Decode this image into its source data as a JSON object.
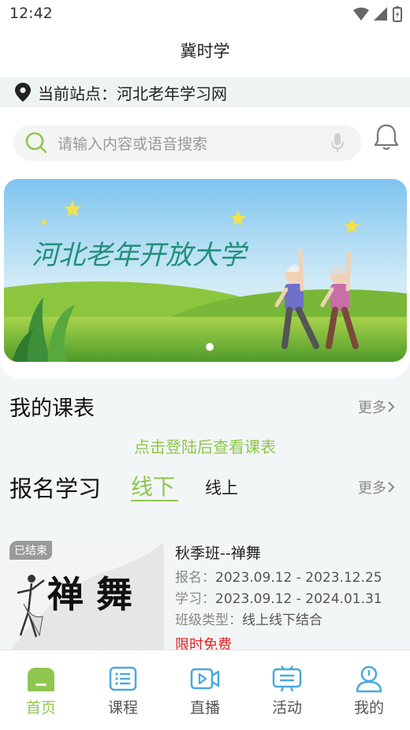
{
  "status": {
    "time": "12:42"
  },
  "header": {
    "title": "冀时学"
  },
  "location": {
    "label": "当前站点：河北老年学习网"
  },
  "search": {
    "placeholder": "请输入内容或语音搜索"
  },
  "banner": {
    "text": "河北老年开放大学"
  },
  "schedule": {
    "title": "我的课表",
    "more": "更多",
    "login_hint": "点击登陆后查看课表"
  },
  "enroll": {
    "title": "报名学习",
    "tabs": [
      {
        "label": "线下",
        "active": true
      },
      {
        "label": "线上",
        "active": false
      }
    ],
    "more": "更多"
  },
  "course": {
    "badge": "已结束",
    "image_text": "禅 舞",
    "name": "秋季班--禅舞",
    "enroll_label": "报名：",
    "enroll_dates": "2023.09.12 - 2023.12.25",
    "study_label": "学习：",
    "study_dates": "2023.09.12 - 2024.01.31",
    "type_label": "班级类型：",
    "type_value": "线上线下结合",
    "price": "限时免费"
  },
  "nav": [
    {
      "label": "首页",
      "icon": "home-icon",
      "active": true
    },
    {
      "label": "课程",
      "icon": "list-icon",
      "active": false
    },
    {
      "label": "直播",
      "icon": "video-icon",
      "active": false
    },
    {
      "label": "活动",
      "icon": "activity-icon",
      "active": false
    },
    {
      "label": "我的",
      "icon": "profile-icon",
      "active": false
    }
  ],
  "colors": {
    "accent": "#8fc650",
    "price": "#e02323"
  }
}
